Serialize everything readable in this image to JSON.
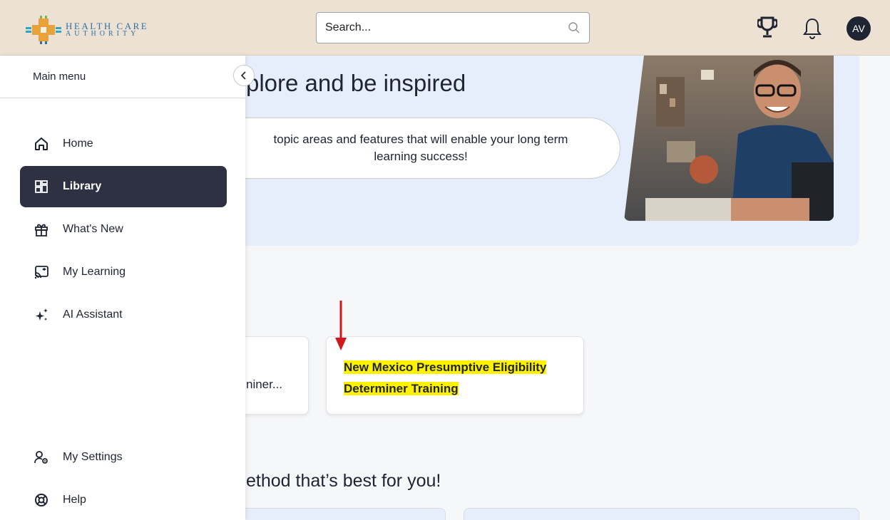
{
  "header": {
    "logo_line1": "HEALTH CARE",
    "logo_line2": "AUTHORITY",
    "search_placeholder": "Search...",
    "avatar_initials": "AV"
  },
  "hero": {
    "title": "plore and be inspired",
    "subtitle": "topic areas and features that will enable your long term learning success!"
  },
  "cards": {
    "card1_text": "niner...",
    "card2_title": "New Mexico Presumptive Eligibility Determiner Training"
  },
  "section": {
    "title": "ethod that’s best for you!"
  },
  "sidebar": {
    "header": "Main menu",
    "items": [
      {
        "label": "Home",
        "icon": "home-icon"
      },
      {
        "label": "Library",
        "icon": "library-icon",
        "active": true
      },
      {
        "label": "What's New",
        "icon": "gift-icon"
      },
      {
        "label": "My Learning",
        "icon": "my-learning-icon"
      },
      {
        "label": "AI Assistant",
        "icon": "sparkle-icon"
      },
      {
        "label": "My Settings",
        "icon": "user-settings-icon"
      },
      {
        "label": "Help",
        "icon": "lifebuoy-icon"
      }
    ]
  },
  "colors": {
    "header_bg": "#ece1d3",
    "active_nav": "#2d3142",
    "highlight": "#fff200",
    "hero_bg": "#e7eefb",
    "annotation_arrow": "#d0181f"
  }
}
